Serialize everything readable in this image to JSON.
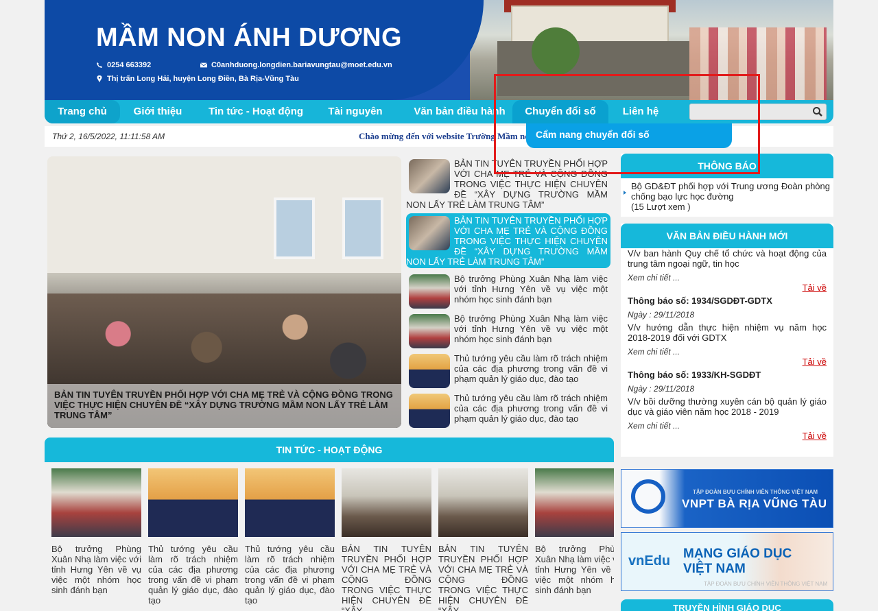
{
  "header": {
    "title": "MẦM NON ÁNH DƯƠNG",
    "phone": "0254 663392",
    "email": "C0anhduong.longdien.bariavungtau@moet.edu.vn",
    "address": "Thị trấn Long Hải, huyện Long Điền, Bà Rịa-Vũng Tàu"
  },
  "nav": {
    "items": [
      "Trang chủ",
      "Giới thiệu",
      "Tin tức - Hoạt động",
      "Tài nguyên",
      "Văn bản điều hành",
      "Chuyển đổi số",
      "Liên hệ"
    ],
    "dropdown_item": "Cẩm nang chuyển đổi số"
  },
  "infobar": {
    "date": "Thứ 2, 16/5/2022, 11:11:58 AM",
    "marquee": "Chào mừng đến với website Trường Mầm non Ánh Dương"
  },
  "featured": {
    "caption": "BẢN TIN TUYÊN TRUYỀN PHỐI HỢP VỚI CHA MẸ TRẺ VÀ CỘNG ĐỒNG TRONG VIỆC THỰC HIỆN CHUYÊN ĐỀ “XÂY DỰNG TRƯỜNG MẦM NON LẤY TRẺ LÀM TRUNG TÂM”"
  },
  "side_list": [
    "BẢN TIN TUYÊN TRUYỀN PHỐI HỢP VỚI CHA MẸ TRẺ VÀ CỘNG ĐỒNG TRONG VIỆC THỰC HIỆN CHUYÊN ĐỀ “XÂY DỰNG TRƯỜNG MẦM NON LẤY TRẺ LÀM TRUNG TÂM”",
    "BẢN TIN TUYÊN TRUYỀN PHỐI HỢP VỚI CHA MẸ TRẺ VÀ CỘNG ĐỒNG TRONG VIỆC THỰC HIỆN CHUYÊN ĐỀ “XÂY DỰNG TRƯỜNG MẦM NON LẤY TRẺ LÀM TRUNG TÂM”",
    "Bộ trưởng Phùng Xuân Nhạ làm việc với tỉnh Hưng Yên về vụ việc một nhóm học sinh đánh bạn",
    "Bộ trưởng Phùng Xuân Nhạ làm việc với tỉnh Hưng Yên về vụ việc một nhóm học sinh đánh bạn",
    "Thủ tướng yêu cầu làm rõ trách nhiệm của các địa phương trong vấn đề vi phạm quản lý giáo dục, đào tạo",
    "Thủ tướng yêu cầu làm rõ trách nhiệm của các địa phương trong vấn đề vi phạm quản lý giáo dục, đào tạo"
  ],
  "news": {
    "heading": "TIN TỨC - HOẠT ĐỘNG",
    "items": [
      "Bộ trưởng Phùng Xuân Nhạ làm việc với tỉnh Hưng Yên về vụ việc một nhóm học sinh đánh bạn",
      "Thủ tướng yêu cầu làm rõ trách nhiệm của các địa phương trong vấn đề vi phạm quản lý giáo dục, đào tạo",
      "Thủ tướng yêu cầu làm rõ trách nhiệm của các địa phương trong vấn đề vi phạm quản lý giáo dục, đào tạo",
      "BẢN TIN TUYÊN TRUYỀN PHỐI HỢP VỚI CHA MẸ TRẺ VÀ CỘNG ĐỒNG TRONG VIỆC THỰC HIỆN CHUYÊN ĐỀ “XÂY",
      "BẢN TIN TUYÊN TRUYỀN PHỐI HỢP VỚI CHA MẸ TRẺ VÀ CỘNG ĐỒNG TRONG VIỆC THỰC HIỆN CHUYÊN ĐỀ “XÂY",
      "Bộ trưởng Phùng Xuân Nhạ làm việc với tỉnh Hưng Yên về vụ việc một nhóm học sinh đánh bạn"
    ]
  },
  "thongbao": {
    "heading": "THÔNG BÁO",
    "item_title": "Bộ GD&ĐT phối hợp với Trung ương Đoàn phòng chống bạo lực học đường",
    "item_views": "(15 Lượt xem )"
  },
  "vanban": {
    "heading": "VĂN BẢN ĐIỀU HÀNH MỚI",
    "first_desc": "V/v ban hành Quy chế tổ chức và hoạt động của trung tâm ngoại ngữ, tin học",
    "more_label": "Xem chi tiết ...",
    "download_label": "Tải về",
    "items": [
      {
        "title": "Thông báo số: 1934/SGDĐT-GDTX",
        "date": "Ngày : 29/11/2018",
        "desc": "V/v hướng dẫn thực hiện nhiệm vụ năm học 2018-2019 đối với GDTX"
      },
      {
        "title": "Thông báo số: 1933/KH-SGDĐT",
        "date": "Ngày : 29/11/2018",
        "desc": "V/v bồi dưỡng thường xuyên cán bộ quản lý giáo dục và giáo viên năm học 2018 - 2019"
      }
    ]
  },
  "banners": {
    "vnpt_small": "TẬP ĐOÀN BƯU CHÍNH VIỄN THÔNG VIỆT NAM",
    "vnpt_big": "VNPT BÀ RỊA VŨNG TÀU",
    "vnedu_logo": "vnEdu",
    "vnedu_title_1": "MẠNG GIÁO DỤC",
    "vnedu_title_2": "VIỆT NAM",
    "vnedu_small": "TẬP ĐOÀN BƯU CHÍNH VIỄN THÔNG VIỆT NAM"
  },
  "tv": {
    "heading": "TRUYỀN HÌNH GIÁO DỤC"
  },
  "colors": {
    "nav": "#17b5d9",
    "header": "#0d4aa6",
    "accent": "#16b8da",
    "highlight": "#e21b1b",
    "download": "#cc0000"
  }
}
